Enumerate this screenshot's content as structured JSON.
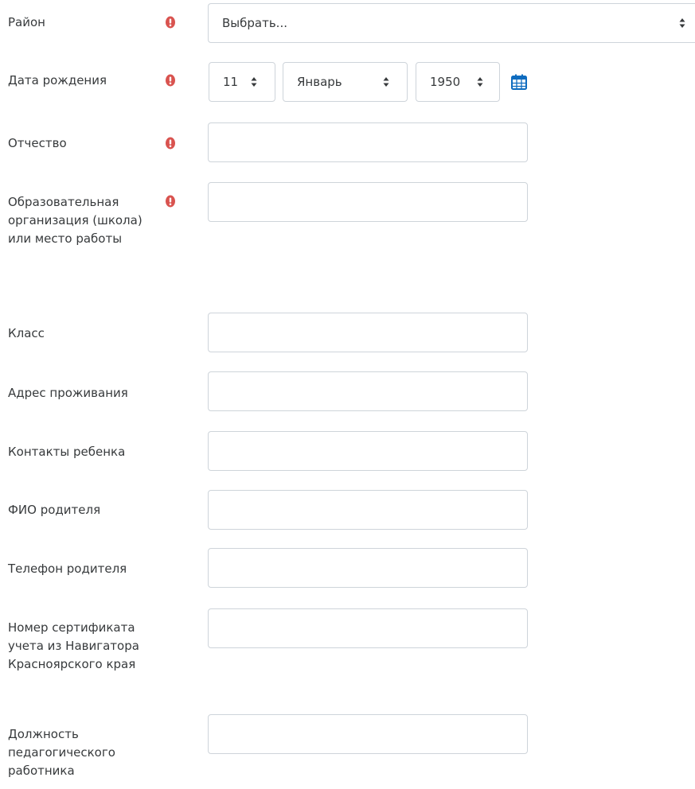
{
  "colors": {
    "required": "#d9534f",
    "calendar": "#0f6cbf",
    "border": "#ced4da",
    "text": "#373a3c"
  },
  "form": {
    "district": {
      "label": "Район",
      "selected": "Выбрать..."
    },
    "birth_date": {
      "label": "Дата рождения",
      "day": "11",
      "month": "Январь",
      "year": "1950"
    },
    "patronymic": {
      "label": "Отчество",
      "value": ""
    },
    "organization": {
      "label": "Образовательная организация (школа) или место работы",
      "value": ""
    },
    "class": {
      "label": "Класс",
      "value": ""
    },
    "address": {
      "label": "Адрес проживания",
      "value": ""
    },
    "child_contacts": {
      "label": "Контакты ребенка",
      "value": ""
    },
    "parent_name": {
      "label": "ФИО родителя",
      "value": ""
    },
    "parent_phone": {
      "label": "Телефон родителя",
      "value": ""
    },
    "certificate_number": {
      "label": "Номер сертификата учета из Навигатора Красноярского края",
      "value": ""
    },
    "position": {
      "label": "Должность педагогического работника",
      "value": ""
    }
  },
  "icons": {
    "required": "exclamation-circle-icon",
    "calendar": "calendar-icon",
    "select_arrow": "sort-arrows-icon"
  }
}
